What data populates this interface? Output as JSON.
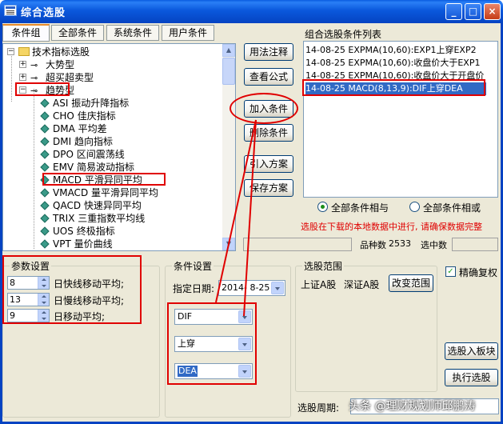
{
  "window": {
    "title": "综合选股",
    "min_glyph": "_",
    "max_glyph": "□",
    "close_glyph": "×"
  },
  "tabs": [
    "条件组",
    "全部条件",
    "系统条件",
    "用户条件"
  ],
  "tree": {
    "root": "技术指标选股",
    "groups": [
      "大势型",
      "超买超卖型",
      "趋势型"
    ],
    "items": [
      {
        "code": "ASI",
        "name": "振动升降指标"
      },
      {
        "code": "CHO",
        "name": "佳庆指标"
      },
      {
        "code": "DMA",
        "name": "平均差"
      },
      {
        "code": "DMI",
        "name": "趋向指标"
      },
      {
        "code": "DPO",
        "name": "区间震荡线"
      },
      {
        "code": "EMV",
        "name": "简易波动指标"
      },
      {
        "code": "MACD",
        "name": "平滑异同平均"
      },
      {
        "code": "VMACD",
        "name": "量平滑异同平均"
      },
      {
        "code": "QACD",
        "name": "快速异同平均"
      },
      {
        "code": "TRIX",
        "name": "三重指数平均线"
      },
      {
        "code": "UOS",
        "name": "终极指标"
      },
      {
        "code": "VPT",
        "name": "量价曲线"
      }
    ]
  },
  "buttons": {
    "usage": "用法注释",
    "formula": "查看公式",
    "add": "加入条件",
    "delete": "删除条件",
    "import": "引入方案",
    "save": "保存方案",
    "change_range": "改变范围",
    "to_sector": "选股入板块",
    "execute": "执行选股"
  },
  "condition_list": {
    "label": "组合选股条件列表",
    "items": [
      "14-08-25 EXPMA(10,60):EXP1上穿EXP2",
      "14-08-25 EXPMA(10,60):收盘价大于EXP1",
      "14-08-25 EXPMA(10,60):收盘价大于开盘价",
      "14-08-25 MACD(8,13,9):DIF上穿DEA"
    ],
    "selected_index": 3
  },
  "logic": {
    "and": "全部条件相与",
    "or": "全部条件相或",
    "selected": "and"
  },
  "warning": "选股在下载的本地数据中进行, 请确保数据完整",
  "status": {
    "count_label": "品种数",
    "count_value": "2533",
    "selected_label": "选中数",
    "selected_value": ""
  },
  "params": {
    "title": "参数设置",
    "rows": [
      {
        "value": "8",
        "label": "日快线移动平均;"
      },
      {
        "value": "13",
        "label": "日慢线移动平均;"
      },
      {
        "value": "9",
        "label": "日移动平均;"
      }
    ]
  },
  "condition": {
    "title": "条件设置",
    "date_label": "指定日期:",
    "date_value": "2014- 8-25",
    "line1": "DIF",
    "operator": "上穿",
    "line2": "DEA"
  },
  "range": {
    "title": "选股范围",
    "market1": "上证A股",
    "market2": "深证A股"
  },
  "adjust": {
    "label": "精确复权",
    "checked": true,
    "check_glyph": "✓"
  },
  "period": {
    "label": "选股周期:"
  },
  "watermark": "头条 @理财规划师邱鹏涛",
  "colors": {
    "titlebar": "#0a58dc",
    "dialog_bg": "#ece9d8",
    "selection": "#316ac5",
    "annotation": "#e00000",
    "warning": "#e00000"
  }
}
